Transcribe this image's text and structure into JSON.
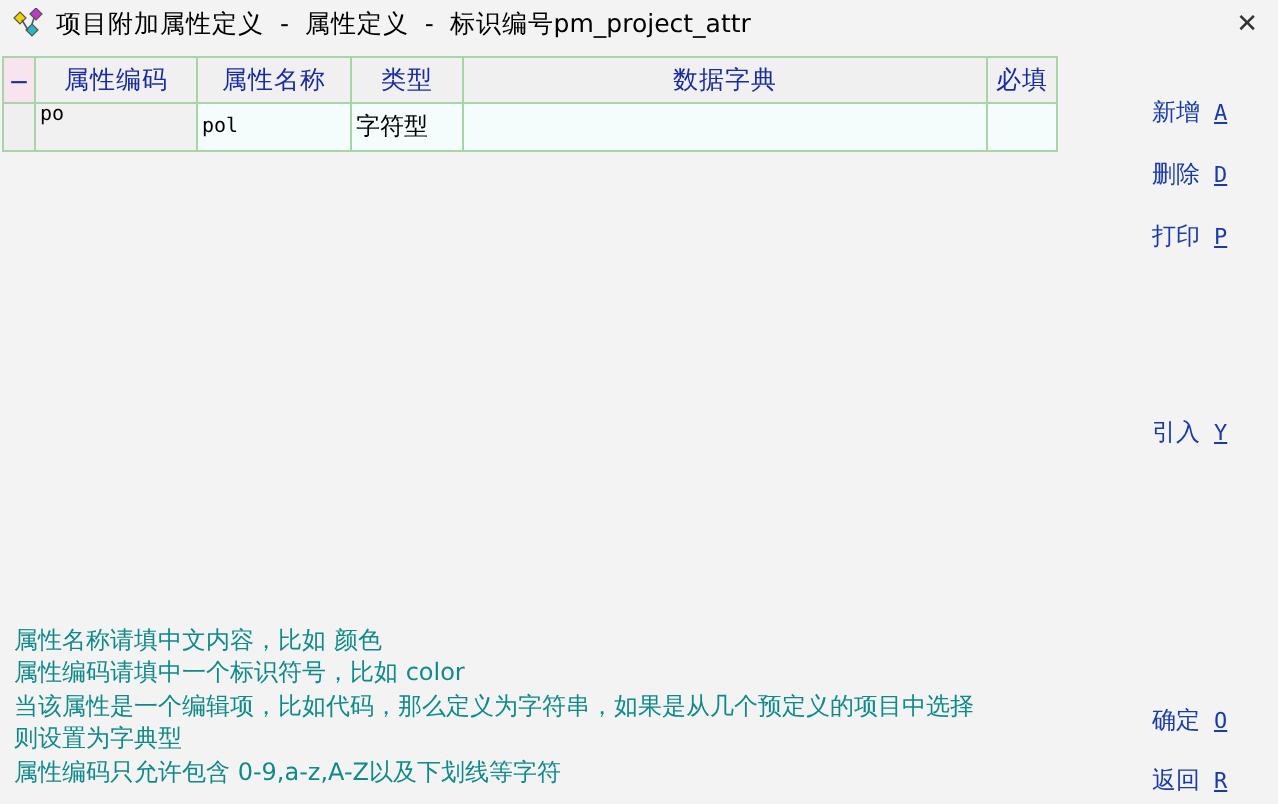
{
  "window": {
    "title": "项目附加属性定义  -  属性定义  -  标识编号pm_project_attr",
    "close": "✕"
  },
  "table": {
    "corner": "−",
    "columns": [
      "属性编码",
      "属性名称",
      "类型",
      "数据字典",
      "必填"
    ],
    "rows": [
      {
        "cells": [
          "po",
          "pol",
          "字符型",
          "",
          ""
        ]
      }
    ]
  },
  "buttons": [
    {
      "label": "新增",
      "key": "A"
    },
    {
      "label": "删除",
      "key": "D"
    },
    {
      "label": "打印",
      "key": "P"
    },
    {
      "label": "引入",
      "key": "Y"
    },
    {
      "label": "确定",
      "key": "O"
    },
    {
      "label": "返回",
      "key": "R"
    }
  ],
  "hints": [
    "属性名称请填中文内容，比如 颜色",
    "属性编码请填中一个标识符号，比如 color",
    "当该属性是一个编辑项，比如代码，那么定义为字符串，如果是从几个预定义的项目中选择",
    "则设置为字典型",
    "属性编码只允许包含 0-9,a-z,A-Z以及下划线等字符"
  ]
}
